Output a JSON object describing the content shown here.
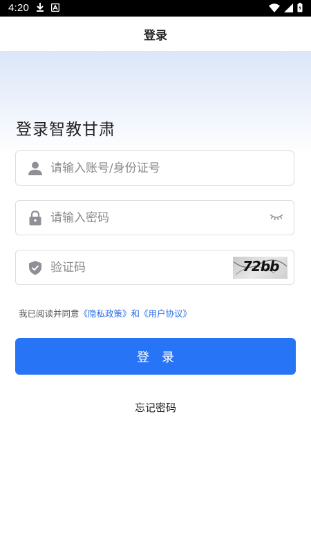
{
  "status_bar": {
    "time": "4:20",
    "left_icons": [
      "download-icon",
      "notification-a-icon"
    ],
    "right_icons": [
      "wifi-icon",
      "signal-icon",
      "battery-icon"
    ]
  },
  "nav": {
    "title": "登录"
  },
  "heading": "登录智教甘肃",
  "form": {
    "account": {
      "placeholder": "请输入账号/身份证号",
      "value": "",
      "icon": "user-icon"
    },
    "password": {
      "placeholder": "请输入密码",
      "value": "",
      "icon": "lock-icon",
      "toggle_icon": "eye-closed-icon"
    },
    "captcha": {
      "placeholder": "验证码",
      "value": "",
      "icon": "shield-icon",
      "captcha_text": "72bb"
    }
  },
  "agreement": {
    "prefix": "我已阅读并同意",
    "privacy_link": "《隐私政策》",
    "joiner": "和",
    "terms_link": "《用户协议》"
  },
  "login_button": "登　录",
  "forgot_password": "忘记密码",
  "colors": {
    "primary": "#2774f6",
    "link": "#2b6fe6",
    "status_bar": "#000000",
    "hero_gradient_top": "#dbe6f8"
  }
}
